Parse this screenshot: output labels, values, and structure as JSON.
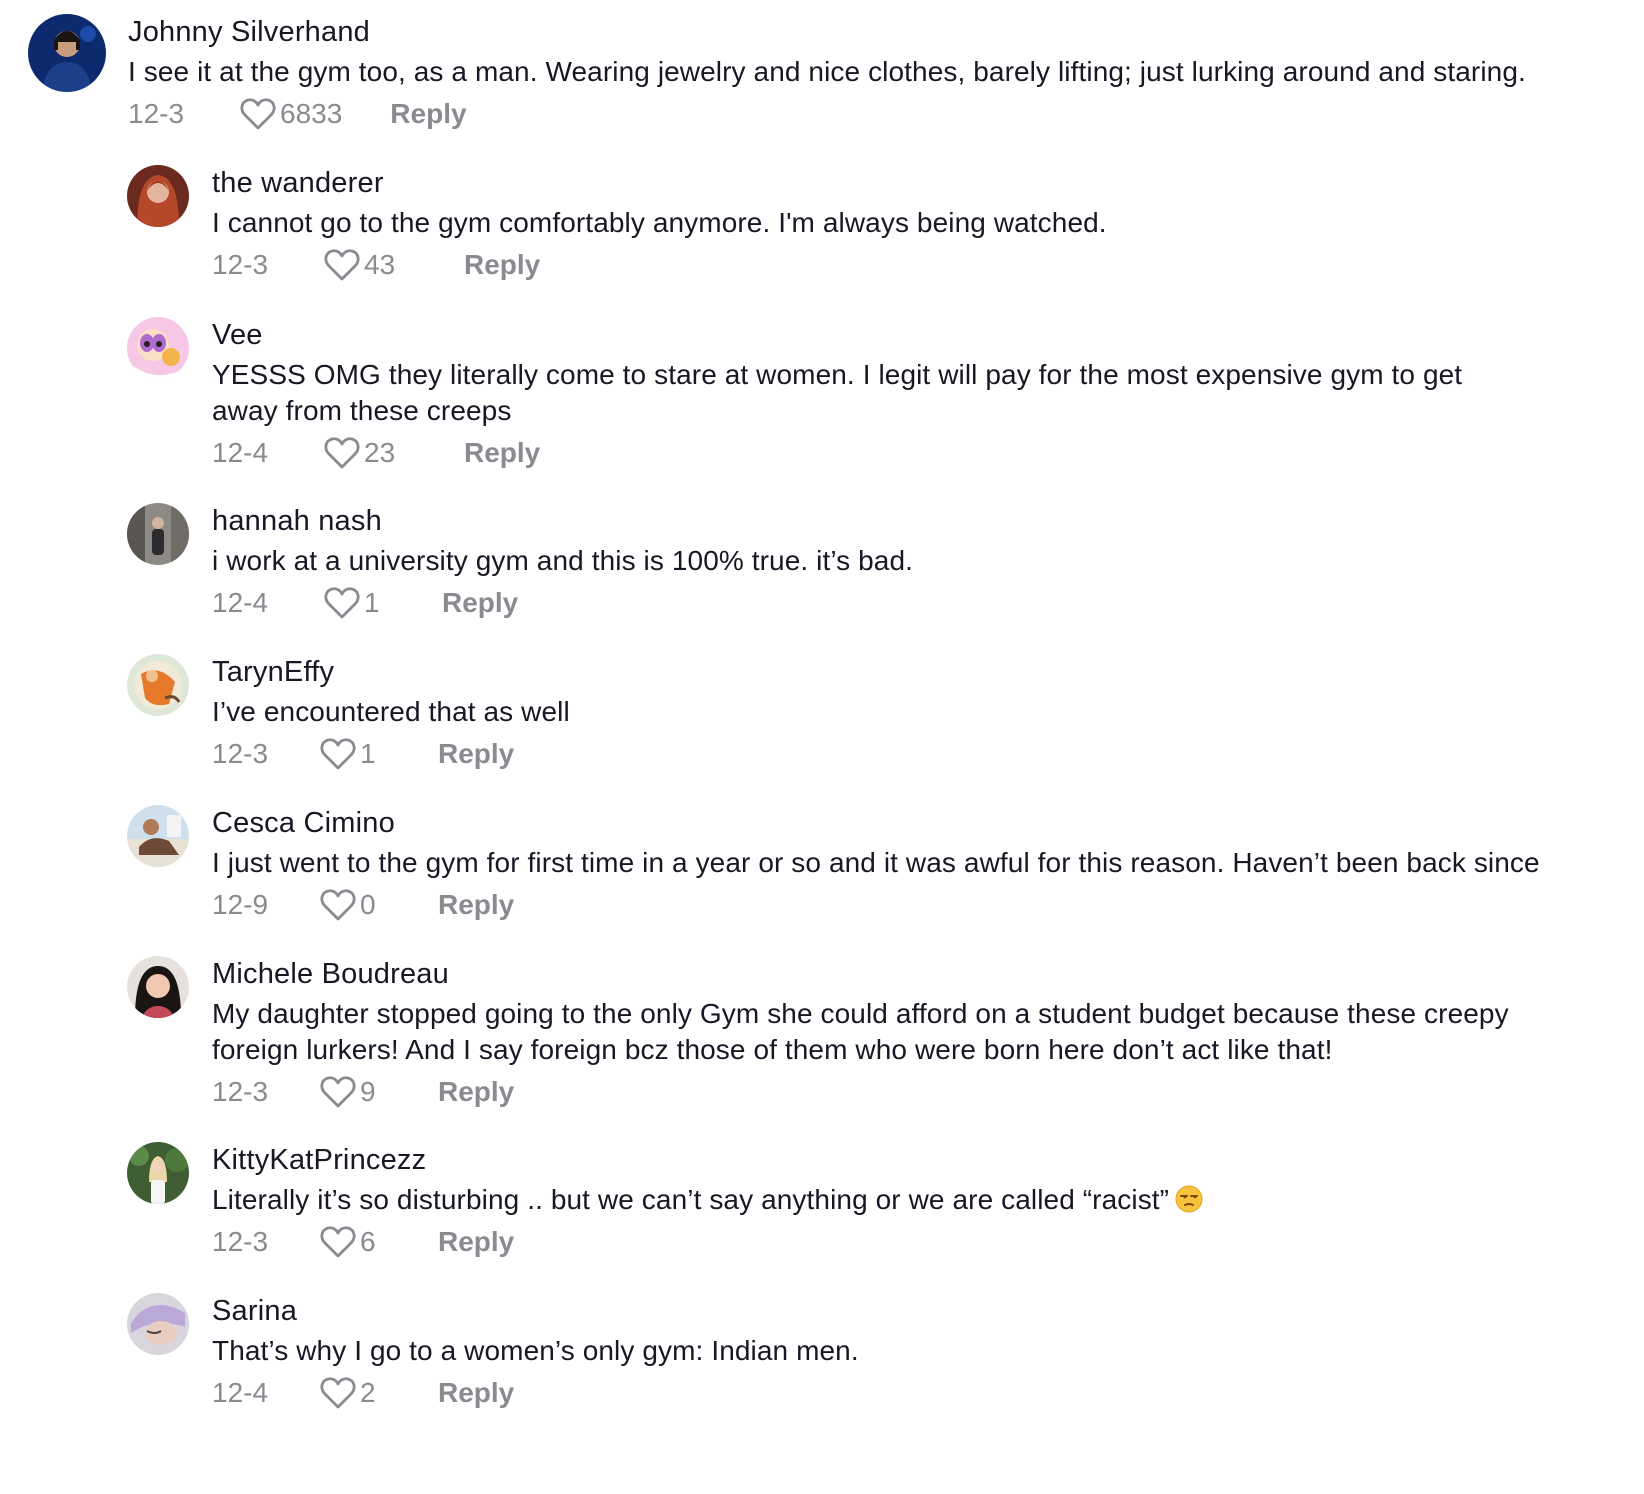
{
  "comments": [
    {
      "username": "Johnny Silverhand",
      "text": "I see it at the gym too, as a man. Wearing jewelry and nice clothes, barely lifting; just lurking around and staring.",
      "date": "12-3",
      "likes": "6833",
      "reply_label": "Reply"
    },
    {
      "username": "the wanderer",
      "text": "I cannot go to the gym comfortably anymore. I'm always being watched.",
      "date": "12-3",
      "likes": "43",
      "reply_label": "Reply"
    },
    {
      "username": "Vee",
      "text": "YESSS OMG they literally come to stare at women. I legit will pay for the most expensive gym to get away from these creeps",
      "date": "12-4",
      "likes": "23",
      "reply_label": "Reply"
    },
    {
      "username": "hannah nash",
      "text": "i work at a university gym and this is 100% true. it’s bad.",
      "date": "12-4",
      "likes": "1",
      "reply_label": "Reply"
    },
    {
      "username": "TarynEffy",
      "text": "I’ve encountered that as well",
      "date": "12-3",
      "likes": "1",
      "reply_label": "Reply"
    },
    {
      "username": "Cesca Cimino",
      "text": "I just went to the gym for first time in a year or so and it was awful for this reason. Haven’t been back since",
      "date": "12-9",
      "likes": "0",
      "reply_label": "Reply"
    },
    {
      "username": "Michele Boudreau",
      "text": "My daughter stopped going to the only Gym she could afford on a student budget because these creepy foreign lurkers! And I say foreign bcz those of them who were born here don’t act like that!",
      "date": "12-3",
      "likes": "9",
      "reply_label": "Reply"
    },
    {
      "username": "KittyKatPrincezz",
      "text": "Literally it’s so disturbing .. but we can’t say anything or we are called “racist”",
      "emoji": "unamused-face-emoji",
      "date": "12-3",
      "likes": "6",
      "reply_label": "Reply"
    },
    {
      "username": "Sarina",
      "text": "That’s why I go to a women’s only gym: Indian men.",
      "date": "12-4",
      "likes": "2",
      "reply_label": "Reply"
    }
  ],
  "icons": {
    "like": "heart-outline-icon"
  },
  "colors": {
    "text": "#161823",
    "meta": "#8a8b91"
  }
}
